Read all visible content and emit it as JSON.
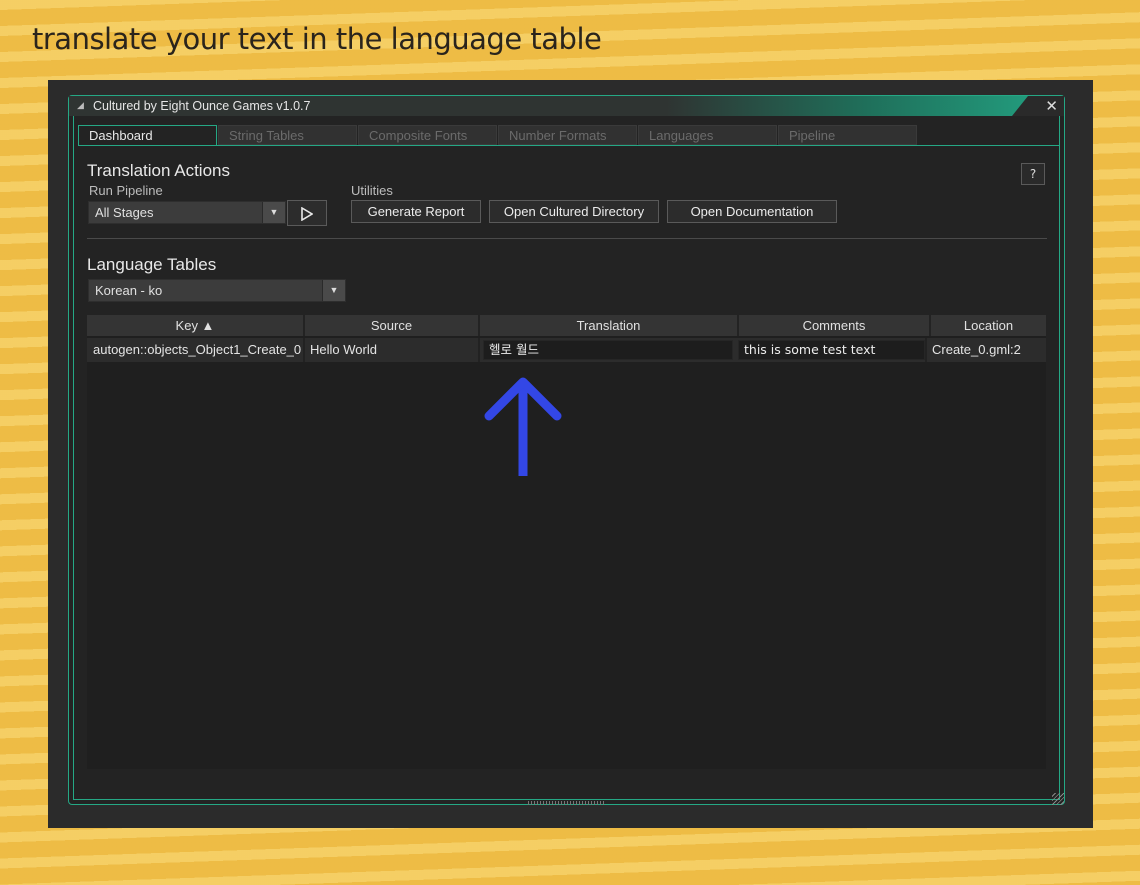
{
  "headline": "translate your text in the language table",
  "window": {
    "title": "Cultured by Eight Ounce Games  v1.0.7",
    "close_symbol": "✕"
  },
  "tabs": [
    {
      "label": "Dashboard",
      "active": true
    },
    {
      "label": "String Tables",
      "active": false
    },
    {
      "label": "Composite Fonts",
      "active": false
    },
    {
      "label": "Number Formats",
      "active": false
    },
    {
      "label": "Languages",
      "active": false
    },
    {
      "label": "Pipeline",
      "active": false
    }
  ],
  "translation_actions": {
    "title": "Translation Actions",
    "help_label": "?",
    "run_pipeline_label": "Run Pipeline",
    "run_pipeline_selected": "All Stages",
    "utilities_label": "Utilities",
    "buttons": {
      "generate_report": "Generate Report",
      "open_directory": "Open Cultured Directory",
      "open_documentation": "Open Documentation"
    }
  },
  "language_tables": {
    "title": "Language Tables",
    "selected_language": "Korean - ko",
    "columns": [
      "Key ▲",
      "Source",
      "Translation",
      "Comments",
      "Location"
    ],
    "rows": [
      {
        "key": "autogen::objects_Object1_Create_0",
        "source": "Hello World",
        "translation": "헬로 월드",
        "comments": "this is some test text",
        "location": "Create_0.gml:2"
      }
    ]
  },
  "annotation": {
    "arrow_color": "#3347e6"
  },
  "colors": {
    "accent": "#25a885",
    "background": "#f0c24f",
    "panel": "#232323"
  },
  "icons": [
    "collapse-triangle-icon",
    "close-icon",
    "chevron-down-icon",
    "play-icon",
    "help-icon",
    "up-arrow-annotation-icon"
  ]
}
